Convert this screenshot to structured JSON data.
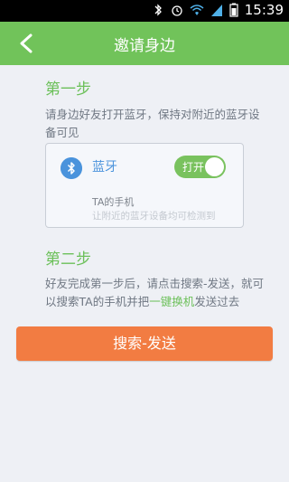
{
  "status_bar": {
    "time": "15:39",
    "icons": [
      "bluetooth-icon",
      "alarm-icon",
      "wifi-icon",
      "signal-icon",
      "battery-icon"
    ]
  },
  "header": {
    "title": "邀请身边",
    "back_icon": "back-arrow-icon"
  },
  "step1": {
    "title": "第一步",
    "description": "请身边好友打开蓝牙，保持对附近的蓝牙设备可见"
  },
  "bluetooth_card": {
    "icon": "bluetooth-icon",
    "label": "蓝牙",
    "toggle_label": "打开",
    "device_name": "TA的手机",
    "visibility_text": "让附近的蓝牙设备均可检测到"
  },
  "step2": {
    "title": "第二步",
    "description_prefix": "好友完成第一步后，请点击搜索-发送，就可以搜索TA的手机并把",
    "description_highlight": "一键换机",
    "description_suffix": "发送过去"
  },
  "action": {
    "button_label": "搜索-发送"
  },
  "colors": {
    "header": "#71c35a",
    "accent_green": "#6cc05a",
    "bluetooth_blue": "#4a93dc",
    "button_orange": "#f27c42",
    "background": "#eef0f5"
  }
}
